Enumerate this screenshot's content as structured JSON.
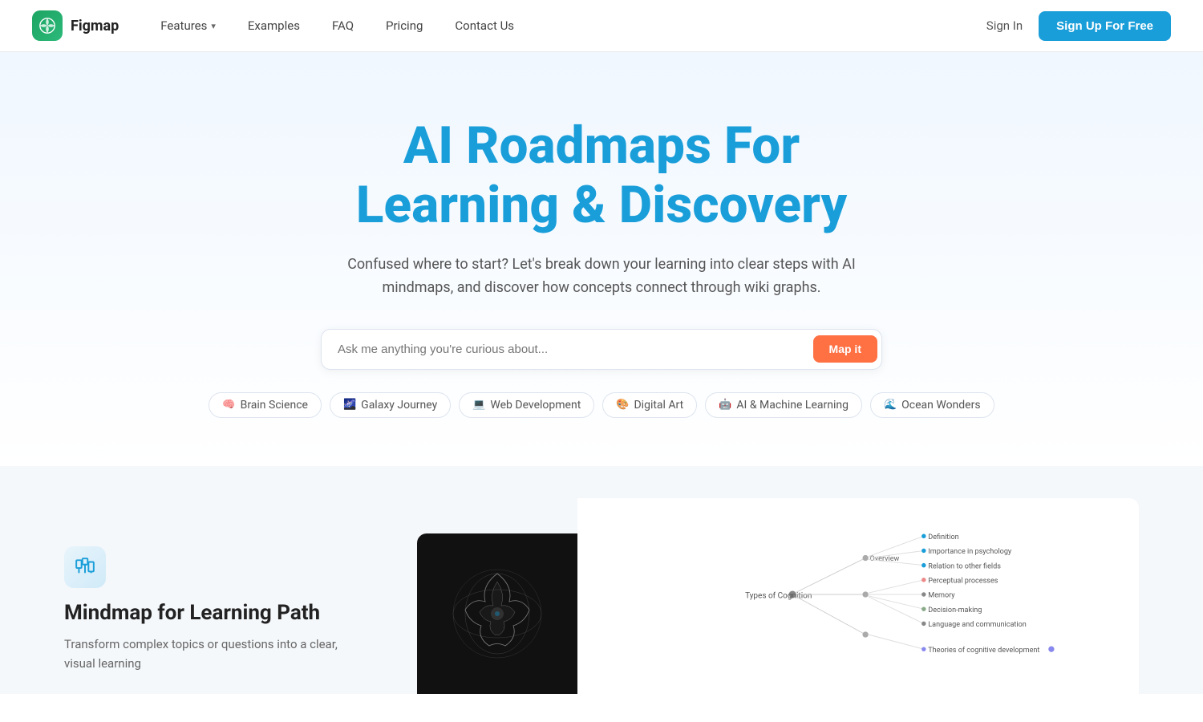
{
  "brand": {
    "name": "Figmap",
    "logo_symbol": "🗺"
  },
  "nav": {
    "links": [
      {
        "label": "Features",
        "has_dropdown": true
      },
      {
        "label": "Examples",
        "has_dropdown": false
      },
      {
        "label": "FAQ",
        "has_dropdown": false
      },
      {
        "label": "Pricing",
        "has_dropdown": false
      },
      {
        "label": "Contact Us",
        "has_dropdown": false
      }
    ],
    "sign_in_label": "Sign In",
    "sign_up_label": "Sign Up For Free"
  },
  "hero": {
    "title_line1": "AI Roadmaps For",
    "title_line2": "Learning & Discovery",
    "subtitle": "Confused where to start? Let's break down your learning into clear steps with AI mindmaps, and discover how concepts connect through wiki graphs.",
    "search_placeholder": "Ask me anything you're curious about...",
    "map_it_label": "Map it",
    "tags": [
      {
        "icon": "🧠",
        "label": "Brain Science"
      },
      {
        "icon": "🌌",
        "label": "Galaxy Journey"
      },
      {
        "icon": "💻",
        "label": "Web Development"
      },
      {
        "icon": "🎨",
        "label": "Digital Art"
      },
      {
        "icon": "🤖",
        "label": "AI & Machine Learning"
      },
      {
        "icon": "🌊",
        "label": "Ocean Wonders"
      }
    ]
  },
  "feature_section": {
    "icon": "🗺",
    "title": "Mindmap for Learning Path",
    "description": "Transform complex topics or questions into a clear, visual learning"
  },
  "mindmap": {
    "center_node": "Types of Cognition",
    "branches": [
      {
        "label": "Overview",
        "children": [
          "Definition",
          "Importance in psychology",
          "Relation to other fields"
        ]
      },
      {
        "label": "Types of Cognition",
        "children": [
          "Perceptual processes",
          "Memory",
          "Decision-making",
          "Language and communication"
        ]
      },
      {
        "label": "",
        "children": [
          "Theories of cognitive development"
        ]
      }
    ]
  },
  "colors": {
    "brand_blue": "#1a9ed9",
    "brand_orange": "#ff7043",
    "brand_green": "#1da462",
    "text_dark": "#222222",
    "text_mid": "#555555",
    "text_light": "#888888",
    "border": "#dde4ef",
    "bg_light": "#f5f8fb"
  }
}
